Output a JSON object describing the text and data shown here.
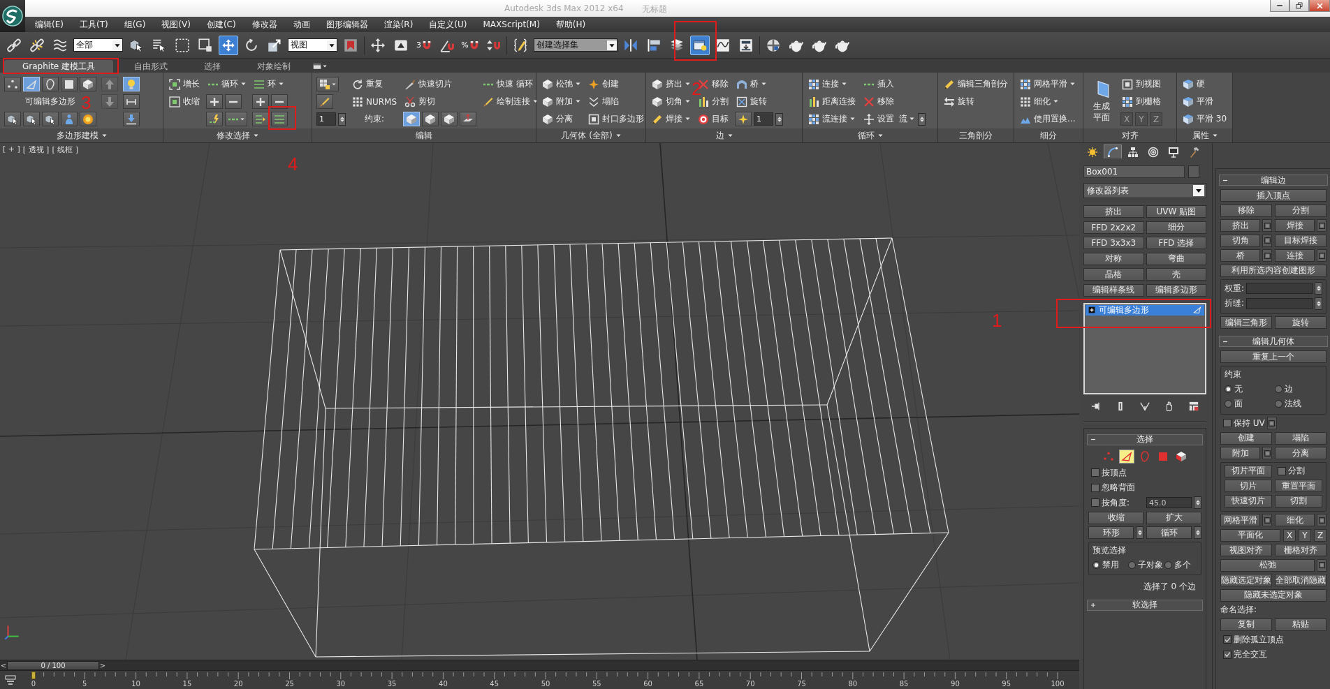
{
  "title_bar": {
    "title": "Autodesk 3ds Max 2012 x64",
    "document": "无标题"
  },
  "menu": [
    "编辑(E)",
    "工具(T)",
    "组(G)",
    "视图(V)",
    "创建(C)",
    "修改器",
    "动画",
    "图形编辑器",
    "渲染(R)",
    "自定义(U)",
    "MAXScript(M)",
    "帮助(H)"
  ],
  "toolbar": {
    "buttons": [
      {
        "active": false
      },
      {
        "active": false
      },
      {
        "active": false
      },
      {
        "active": false
      },
      {
        "active": false
      },
      {
        "active": false
      },
      {
        "active": false
      },
      {
        "active": true
      },
      {
        "active": false
      },
      {
        "active": false
      },
      {
        "active": false
      },
      {
        "active": false
      },
      {
        "active": false
      },
      {
        "active": false,
        "label": "3"
      },
      {
        "active": false
      },
      {
        "active": false,
        "label": "%"
      },
      {
        "active": false
      },
      {
        "active": false
      },
      {
        "active": false
      },
      {
        "active": false
      },
      {
        "active": false
      },
      {
        "active": true
      },
      {
        "active": false
      },
      {
        "active": false
      },
      {
        "active": false
      },
      {
        "active": false
      },
      {
        "active": false
      },
      {
        "active": false
      }
    ],
    "dropdowns": [
      {
        "value": "全部",
        "disabled": false
      },
      {
        "value": "视图",
        "disabled": false
      },
      {
        "value": "创建选择集",
        "disabled": true
      }
    ]
  },
  "ribbon": {
    "tabs": [
      {
        "label": "Graphite 建模工具",
        "selected": true
      },
      {
        "label": "自由形式",
        "selected": false
      },
      {
        "label": "选择",
        "selected": false
      },
      {
        "label": "对象绘制",
        "selected": false
      }
    ],
    "groups": [
      {
        "label": "多边形建模",
        "menu": true,
        "columns": [
          [
            {
              "kind": "icons",
              "buttons": [
                {
                  "selected": false
                },
                {
                  "selected": true
                },
                {
                  "selected": false
                },
                {
                  "selected": false
                },
                {
                  "selected": false
                }
              ]
            },
            {
              "kind": "text",
              "label": "可编辑多边形"
            },
            {
              "kind": "icons",
              "buttons": [
                {
                  "selected": false
                },
                {
                  "selected": false
                },
                {
                  "selected": false
                },
                {
                  "selected": false
                },
                {
                  "selected": false
                }
              ]
            }
          ],
          [
            {
              "kind": "icons",
              "buttons": [
                {
                  "selected": false,
                  "disabled": true
                }
              ]
            },
            {
              "kind": "icons",
              "buttons": [
                {
                  "selected": false,
                  "disabled": true
                }
              ]
            }
          ],
          [
            {
              "kind": "icons",
              "buttons": [
                {
                  "selected": true
                }
              ]
            },
            {
              "kind": "icons",
              "buttons": [
                {
                  "selected": false
                }
              ]
            },
            {
              "kind": "icons",
              "buttons": [
                {
                  "selected": false
                }
              ]
            }
          ]
        ]
      },
      {
        "label": "修改选择",
        "menu": true,
        "columns": [
          [
            {
              "kind": "tool",
              "label": "增长"
            },
            {
              "kind": "tool",
              "label": "收缩"
            }
          ],
          [
            {
              "kind": "tool",
              "label": "循环",
              "dropdown": true
            },
            {
              "kind": "icons",
              "buttons": [
                {
                  "selected": false
                },
                {
                  "selected": false
                }
              ]
            },
            {
              "kind": "icons",
              "buttons": [
                {
                  "selected": false
                },
                {
                  "selected": false,
                  "dropdown": true
                }
              ]
            }
          ],
          [
            {
              "kind": "tool",
              "label": "环",
              "dropdown": true
            },
            {
              "kind": "icons",
              "buttons": [
                {
                  "selected": false
                },
                {
                  "selected": false
                }
              ]
            },
            {
              "kind": "icons",
              "buttons": [
                {
                  "selected": false
                },
                {
                  "selected": false
                }
              ]
            }
          ]
        ]
      },
      {
        "label": "编辑",
        "columns": [
          [
            {
              "kind": "icons",
              "buttons": [
                {
                  "selected": false,
                  "dropdown": true
                }
              ]
            },
            {
              "kind": "icons",
              "buttons": [
                {
                  "selected": false
                }
              ]
            },
            {
              "kind": "spinner",
              "value": "1"
            }
          ],
          [
            {
              "kind": "tool",
              "label": "重复"
            },
            {
              "kind": "tool",
              "label": "NURMS"
            },
            {
              "kind": "text",
              "label": "约束:"
            }
          ],
          [
            {
              "kind": "tool",
              "label": "快速切片"
            },
            {
              "kind": "tool",
              "label": "剪切"
            },
            {
              "kind": "icons",
              "buttons": [
                {
                  "selected": true
                },
                {
                  "selected": false
                },
                {
                  "selected": false
                },
                {
                  "selected": false
                }
              ]
            }
          ],
          [
            {
              "kind": "tool",
              "label": "快速 循环"
            },
            {
              "kind": "tool",
              "label": "绘制连接",
              "dropdown": true
            }
          ]
        ]
      },
      {
        "label": "几何体 (全部)",
        "menu": true,
        "columns": [
          [
            {
              "kind": "tool",
              "label": "松弛",
              "dropdown": true
            },
            {
              "kind": "tool",
              "label": "附加",
              "dropdown": true
            },
            {
              "kind": "tool",
              "label": "分离"
            }
          ],
          [
            {
              "kind": "tool",
              "label": "创建"
            },
            {
              "kind": "tool",
              "label": "塌陷"
            },
            {
              "kind": "tool",
              "label": "封口多边形"
            }
          ]
        ]
      },
      {
        "label": "边",
        "menu": true,
        "columns": [
          [
            {
              "kind": "tool",
              "label": "挤出",
              "dropdown": true
            },
            {
              "kind": "tool",
              "label": "切角",
              "dropdown": true
            },
            {
              "kind": "tool",
              "label": "焊接",
              "dropdown": true
            }
          ],
          [
            {
              "kind": "tool",
              "label": "移除"
            },
            {
              "kind": "tool",
              "label": "分割"
            },
            {
              "kind": "tool",
              "label": "目标"
            }
          ],
          [
            {
              "kind": "tool",
              "label": "桥",
              "dropdown": true
            },
            {
              "kind": "tool",
              "label": "旋转"
            },
            {
              "kind": "iconspinner",
              "value": "1"
            }
          ]
        ]
      },
      {
        "label": "循环",
        "menu": true,
        "columns": [
          [
            {
              "kind": "tool",
              "label": "连接",
              "dropdown": true
            },
            {
              "kind": "tool",
              "label": "距离连接"
            },
            {
              "kind": "tool",
              "label": "流连接",
              "dropdown": true
            }
          ],
          [
            {
              "kind": "tool",
              "label": "插入"
            },
            {
              "kind": "tool",
              "label": "移除"
            },
            {
              "kind": "setting",
              "label": "设置",
              "option": "流",
              "dropdown": true
            }
          ]
        ]
      },
      {
        "label": "三角剖分",
        "columns": [
          [
            {
              "kind": "tool",
              "label": "编辑三角剖分"
            },
            {
              "kind": "tool",
              "label": "旋转"
            }
          ]
        ]
      },
      {
        "label": "细分",
        "columns": [
          [
            {
              "kind": "tool",
              "label": "网格平滑",
              "dropdown": true
            },
            {
              "kind": "tool",
              "label": "细化",
              "dropdown": true
            },
            {
              "kind": "tool",
              "label": "使用置换..."
            }
          ]
        ]
      },
      {
        "label": "对齐",
        "columns": [
          [
            {
              "kind": "big",
              "label": "生成平面"
            }
          ],
          [
            {
              "kind": "tool",
              "label": "到视图"
            },
            {
              "kind": "tool",
              "label": "到栅格"
            },
            {
              "kind": "axes",
              "labels": [
                "X",
                "Y",
                "Z"
              ],
              "disabled": true
            }
          ]
        ]
      },
      {
        "label": "属性",
        "menu": true,
        "columns": [
          [
            {
              "kind": "tool",
              "label": "硬"
            },
            {
              "kind": "tool",
              "label": "平滑"
            },
            {
              "kind": "tool",
              "label": "平滑 30"
            }
          ]
        ]
      }
    ]
  },
  "viewport": {
    "labels": [
      "[ + ]",
      "[ 透视 ]",
      "[ 线框 ]"
    ]
  },
  "command_panel": {
    "tabs": [
      {
        "selected": false
      },
      {
        "selected": true
      },
      {
        "selected": false
      },
      {
        "selected": false
      },
      {
        "selected": false
      },
      {
        "selected": false
      }
    ],
    "object_name": "Box001",
    "modifier_list": "修改器列表",
    "modifier_buttons": [
      "挤出",
      "UVW 贴图",
      "FFD 2x2x2",
      "细分",
      "FFD 3x3x3",
      "FFD 选择",
      "对称",
      "弯曲",
      "晶格",
      "壳",
      "编辑样条线",
      "编辑多边形"
    ],
    "stack": [
      {
        "label": "可编辑多边形",
        "selected": true
      }
    ],
    "left_rollouts": [
      {
        "title": "选择",
        "expanded": true,
        "content": [
          {
            "kind": "levels",
            "levels": [
              {
                "selected": false
              },
              {
                "selected": true
              },
              {
                "selected": false
              },
              {
                "selected": false
              },
              {
                "selected": false
              }
            ]
          },
          {
            "kind": "row",
            "items": [
              {
                "kind": "check",
                "label": "按顶点",
                "checked": false
              }
            ]
          },
          {
            "kind": "row",
            "items": [
              {
                "kind": "check",
                "label": "忽略背面",
                "checked": false
              }
            ]
          },
          {
            "kind": "row",
            "items": [
              {
                "kind": "check",
                "label": "按角度:",
                "checked": false
              },
              {
                "kind": "field",
                "value": "45.0"
              }
            ]
          },
          {
            "kind": "row",
            "items": [
              {
                "kind": "button",
                "label": "收缩"
              },
              {
                "kind": "button",
                "label": "扩大"
              }
            ]
          },
          {
            "kind": "row",
            "items": [
              {
                "kind": "spinbutton",
                "label": "环形"
              },
              {
                "kind": "spinbutton",
                "label": "循环"
              }
            ]
          },
          {
            "kind": "frame",
            "title": "预览选择",
            "rows": [
              [
                {
                  "kind": "radio",
                  "label": "禁用",
                  "selected": true
                },
                {
                  "kind": "radio",
                  "label": "子对象",
                  "selected": false
                },
                {
                  "kind": "radio",
                  "label": "多个",
                  "selected": false
                }
              ]
            ]
          },
          {
            "kind": "status",
            "label": "选择了 0 个边"
          }
        ]
      },
      {
        "title": "软选择",
        "expanded": false
      }
    ],
    "right_rollouts": [
      {
        "title": "编辑边",
        "expanded": true,
        "content": [
          {
            "kind": "row",
            "items": [
              {
                "kind": "button",
                "label": "插入顶点"
              }
            ]
          },
          {
            "kind": "row",
            "items": [
              {
                "kind": "button",
                "label": "移除"
              },
              {
                "kind": "button",
                "label": "分割"
              }
            ]
          },
          {
            "kind": "row",
            "items": [
              {
                "kind": "button",
                "label": "挤出",
                "settings": true
              },
              {
                "kind": "button",
                "label": "焊接",
                "settings": true
              }
            ]
          },
          {
            "kind": "row",
            "items": [
              {
                "kind": "button",
                "label": "切角",
                "settings": true
              },
              {
                "kind": "button",
                "label": "目标焊接"
              }
            ]
          },
          {
            "kind": "row",
            "items": [
              {
                "kind": "button",
                "label": "桥",
                "settings": true
              },
              {
                "kind": "button",
                "label": "连接",
                "settings": true
              }
            ]
          },
          {
            "kind": "row",
            "items": [
              {
                "kind": "button",
                "label": "利用所选内容创建图形"
              }
            ]
          },
          {
            "kind": "frame",
            "rows": [
              [
                {
                  "kind": "field",
                  "label": "权重:"
                }
              ],
              [
                {
                  "kind": "field",
                  "label": "折缝:"
                }
              ]
            ]
          },
          {
            "kind": "row",
            "items": [
              {
                "kind": "button",
                "label": "编辑三角形"
              },
              {
                "kind": "button",
                "label": "旋转"
              }
            ]
          }
        ]
      },
      {
        "title": "编辑几何体",
        "expanded": true,
        "content": [
          {
            "kind": "row",
            "items": [
              {
                "kind": "button",
                "label": "重复上一个"
              }
            ]
          },
          {
            "kind": "frame",
            "title": "约束",
            "rows": [
              [
                {
                  "kind": "radio",
                  "label": "无",
                  "selected": true
                },
                {
                  "kind": "radio",
                  "label": "边",
                  "selected": false
                }
              ],
              [
                {
                  "kind": "radio",
                  "label": "面",
                  "selected": false
                },
                {
                  "kind": "radio",
                  "label": "法线",
                  "selected": false
                }
              ]
            ]
          },
          {
            "kind": "row",
            "items": [
              {
                "kind": "check",
                "label": "保持 UV",
                "checked": false,
                "settings": true
              }
            ]
          },
          {
            "kind": "row",
            "items": [
              {
                "kind": "button",
                "label": "创建"
              },
              {
                "kind": "button",
                "label": "塌陷"
              }
            ]
          },
          {
            "kind": "row",
            "items": [
              {
                "kind": "button",
                "label": "附加",
                "settings": true
              },
              {
                "kind": "button",
                "label": "分离"
              }
            ]
          },
          {
            "kind": "frame",
            "rows": [
              [
                {
                  "kind": "button",
                  "label": "切片平面"
                },
                {
                  "kind": "check",
                  "label": "分割",
                  "checked": false
                }
              ],
              [
                {
                  "kind": "button",
                  "label": "切片"
                },
                {
                  "kind": "button",
                  "label": "重置平面"
                }
              ],
              [
                {
                  "kind": "button",
                  "label": "快速切片"
                },
                {
                  "kind": "button",
                  "label": "切割"
                }
              ]
            ]
          },
          {
            "kind": "row",
            "items": [
              {
                "kind": "button",
                "label": "网格平滑",
                "settings": true
              },
              {
                "kind": "button",
                "label": "细化",
                "settings": true
              }
            ]
          },
          {
            "kind": "row",
            "items": [
              {
                "kind": "button",
                "label": "平面化"
              },
              {
                "kind": "axis",
                "label": "X"
              },
              {
                "kind": "axis",
                "label": "Y"
              },
              {
                "kind": "axis",
                "label": "Z"
              }
            ]
          },
          {
            "kind": "row",
            "items": [
              {
                "kind": "button",
                "label": "视图对齐"
              },
              {
                "kind": "button",
                "label": "栅格对齐"
              }
            ]
          },
          {
            "kind": "row",
            "items": [
              {
                "kind": "button",
                "label": "松弛",
                "settings": true
              }
            ]
          },
          {
            "kind": "row",
            "items": [
              {
                "kind": "button",
                "label": "隐藏选定对象"
              },
              {
                "kind": "button",
                "label": "全部取消隐藏"
              }
            ]
          },
          {
            "kind": "row",
            "items": [
              {
                "kind": "button",
                "label": "隐藏未选定对象"
              }
            ]
          },
          {
            "kind": "label",
            "label": "命名选择:"
          },
          {
            "kind": "row",
            "items": [
              {
                "kind": "button",
                "label": "复制"
              },
              {
                "kind": "button",
                "label": "粘贴"
              }
            ]
          },
          {
            "kind": "row",
            "items": [
              {
                "kind": "check",
                "label": "删除孤立顶点",
                "checked": true
              }
            ]
          },
          {
            "kind": "row",
            "items": [
              {
                "kind": "check",
                "label": "完全交互",
                "checked": true
              }
            ]
          }
        ]
      }
    ]
  },
  "time_slider": {
    "previous": "<",
    "position": "0 / 100",
    "next": ">",
    "level": 0
  },
  "track_bar": {
    "labels": [
      "0",
      "5",
      "10",
      "15",
      "20",
      "25",
      "30",
      "35",
      "40",
      "45",
      "50",
      "55",
      "60",
      "65",
      "70",
      "75",
      "80",
      "85",
      "90",
      "95",
      "100"
    ]
  },
  "annotations": [
    {
      "label": "1"
    },
    {
      "label": "2"
    },
    {
      "label": "3"
    },
    {
      "label": "4"
    }
  ]
}
